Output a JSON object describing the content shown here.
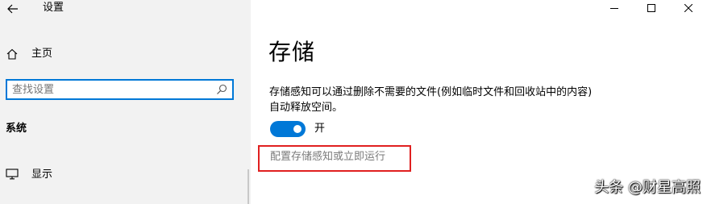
{
  "window": {
    "title": "设置",
    "controls": {
      "minimize_icon": "minimize-icon",
      "maximize_icon": "maximize-icon",
      "close_icon": "close-icon"
    }
  },
  "sidebar": {
    "back_icon": "back-arrow-icon",
    "home": {
      "icon": "home-icon",
      "label": "主页"
    },
    "search": {
      "placeholder": "查找设置",
      "value": "",
      "icon": "search-icon"
    },
    "section_label": "系统",
    "items": [
      {
        "icon": "monitor-icon",
        "label": "显示"
      }
    ]
  },
  "main": {
    "page_title": "存储",
    "description_line1": "存储感知可以通过删除不需要的文件(例如临时文件和回收站中的内容)",
    "description_line2": "自动释放空间。",
    "toggle": {
      "on": true,
      "state_label": "开"
    },
    "configure_link": "配置存储感知或立即运行"
  },
  "watermark": "头条 @财星高照",
  "colors": {
    "accent": "#0078d7",
    "nav_background": "#f2f2f2",
    "link_gray": "#7a7a7a",
    "highlight_red": "#e02020"
  }
}
